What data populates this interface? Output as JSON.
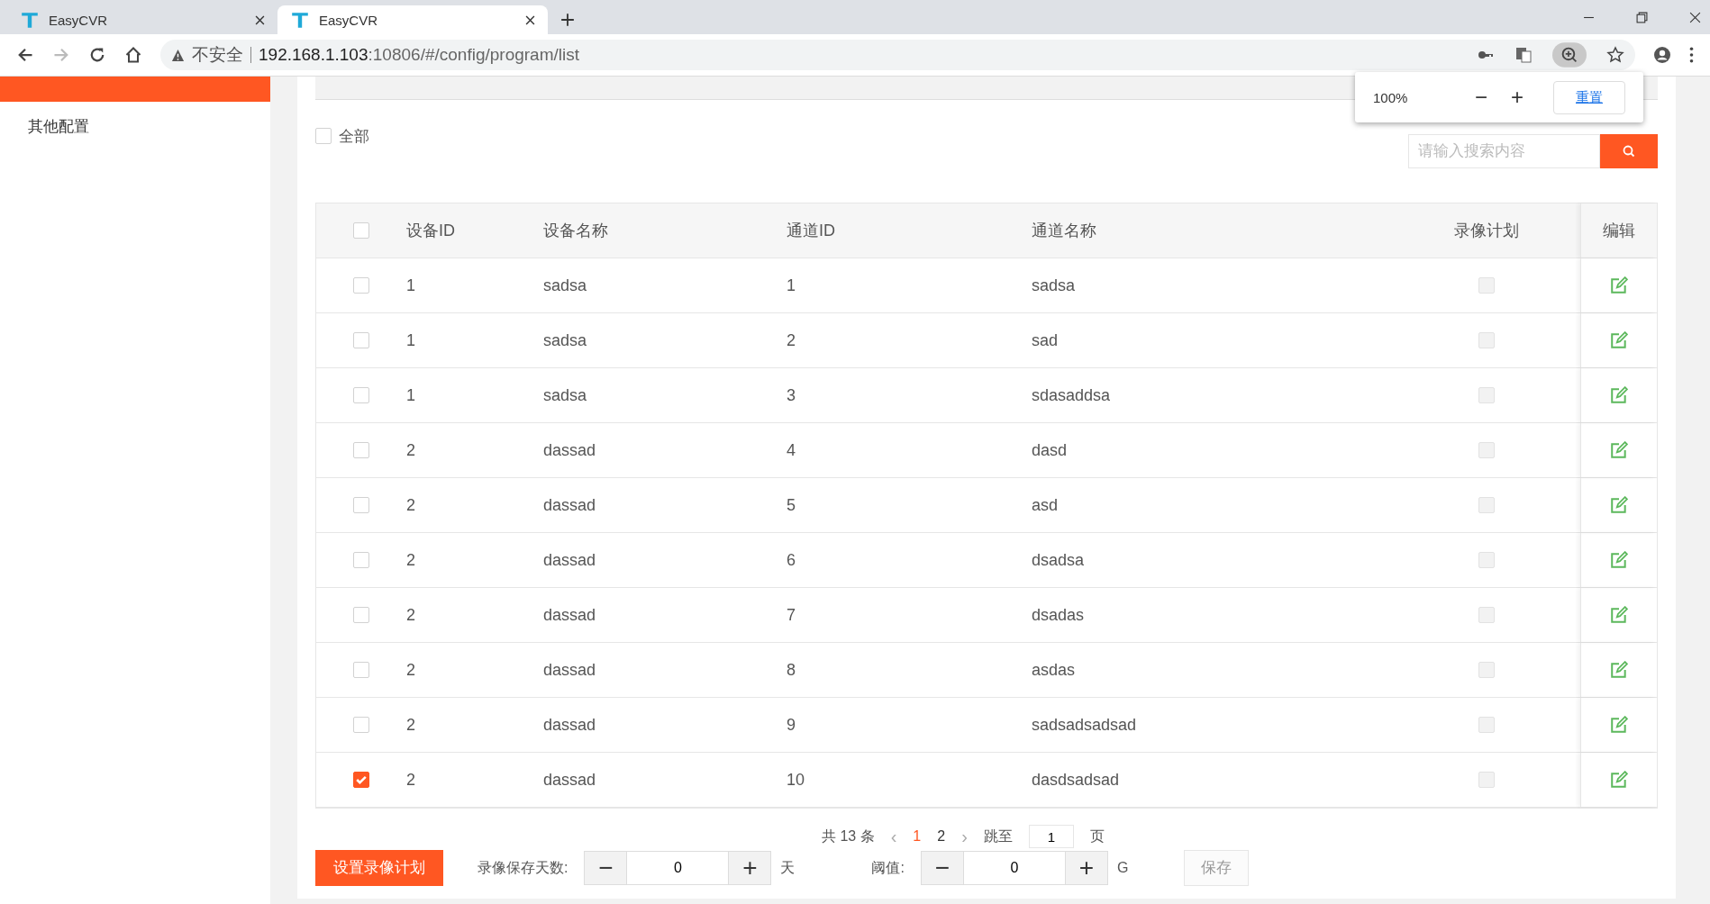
{
  "browser": {
    "tabs": [
      {
        "title": "EasyCVR",
        "selected": false
      },
      {
        "title": "EasyCVR",
        "selected": true
      }
    ],
    "security": "不安全",
    "url_host": "192.168.1.103",
    "url_rest": ":10806/#/config/program/list"
  },
  "zoom_popup": {
    "value": "100%",
    "minus": "−",
    "plus": "+",
    "reset": "重置"
  },
  "sidebar": {
    "items": [
      {
        "label": "其他配置"
      }
    ]
  },
  "filter": {
    "all_label": "全部",
    "all_checked": false,
    "search_placeholder": "请输入搜索内容"
  },
  "table": {
    "columns": [
      "设备ID",
      "设备名称",
      "通道ID",
      "通道名称",
      "录像计划",
      "编辑"
    ],
    "all_checked": false,
    "rows": [
      {
        "device_id": "1",
        "device_name": "sadsa",
        "channel_id": "1",
        "channel_name": "sadsa",
        "checked": false,
        "plan": false
      },
      {
        "device_id": "1",
        "device_name": "sadsa",
        "channel_id": "2",
        "channel_name": "sad",
        "checked": false,
        "plan": false
      },
      {
        "device_id": "1",
        "device_name": "sadsa",
        "channel_id": "3",
        "channel_name": "sdasaddsa",
        "checked": false,
        "plan": false
      },
      {
        "device_id": "2",
        "device_name": "dassad",
        "channel_id": "4",
        "channel_name": "dasd",
        "checked": false,
        "plan": false
      },
      {
        "device_id": "2",
        "device_name": "dassad",
        "channel_id": "5",
        "channel_name": "asd",
        "checked": false,
        "plan": false
      },
      {
        "device_id": "2",
        "device_name": "dassad",
        "channel_id": "6",
        "channel_name": "dsadsa",
        "checked": false,
        "plan": false
      },
      {
        "device_id": "2",
        "device_name": "dassad",
        "channel_id": "7",
        "channel_name": "dsadas",
        "checked": false,
        "plan": false
      },
      {
        "device_id": "2",
        "device_name": "dassad",
        "channel_id": "8",
        "channel_name": "asdas",
        "checked": false,
        "plan": false
      },
      {
        "device_id": "2",
        "device_name": "dassad",
        "channel_id": "9",
        "channel_name": "sadsadsadsad",
        "checked": false,
        "plan": false
      },
      {
        "device_id": "2",
        "device_name": "dassad",
        "channel_id": "10",
        "channel_name": "dasdsadsad",
        "checked": true,
        "plan": false
      }
    ]
  },
  "pagination": {
    "total": "共 13 条",
    "prev": "‹",
    "pages": [
      {
        "label": "1",
        "selected": true
      },
      {
        "label": "2",
        "selected": false
      }
    ],
    "next": "›",
    "jump_label": "跳至",
    "jump_value": "1",
    "page_unit": "页"
  },
  "footer": {
    "set_plan_button": "设置录像计划",
    "days_label": "录像保存天数:",
    "days_value": "0",
    "days_unit": "天",
    "threshold_label": "阈值:",
    "threshold_value": "0",
    "threshold_unit": "G",
    "minus": "−",
    "plus": "+",
    "save_button": "保存"
  }
}
